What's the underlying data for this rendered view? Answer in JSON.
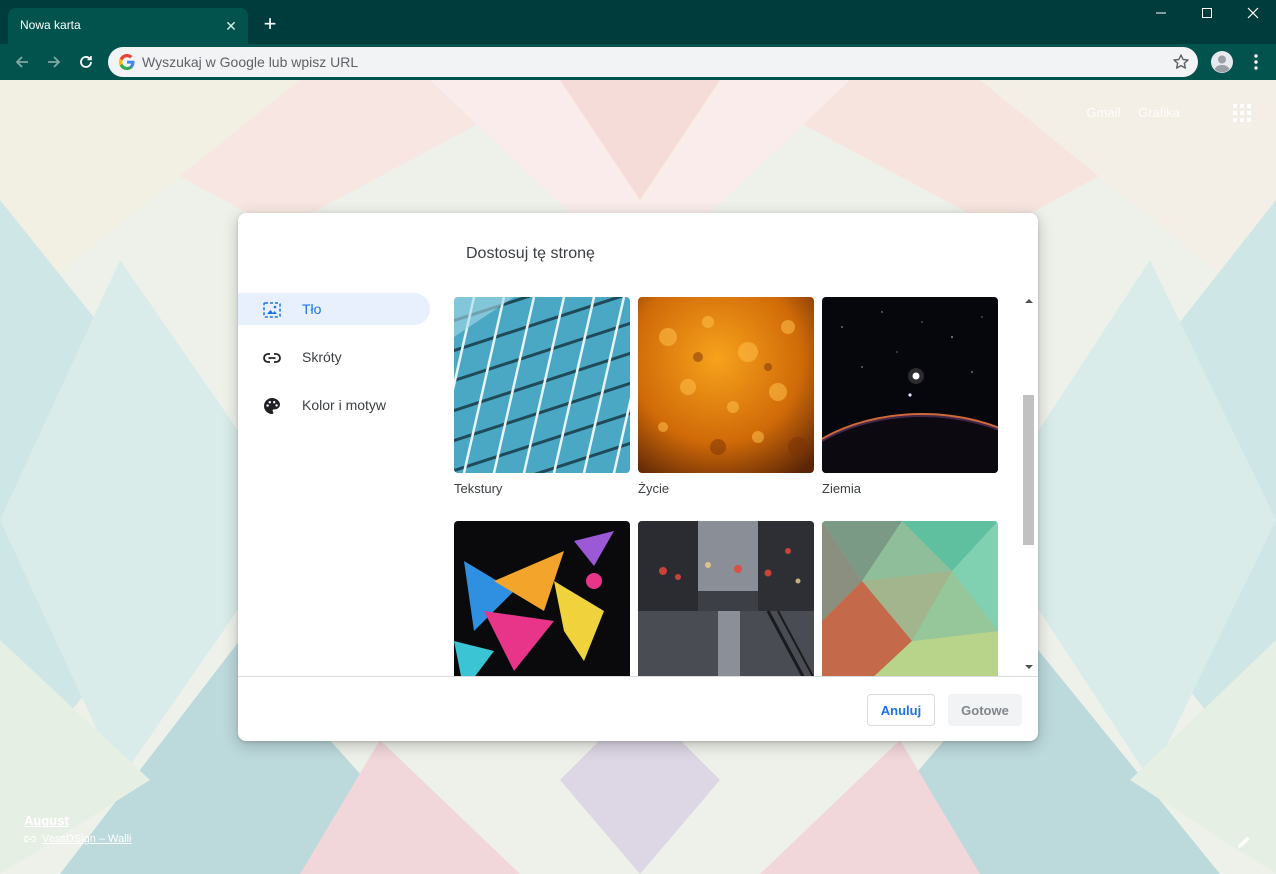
{
  "browser": {
    "tab_title": "Nowa karta",
    "omnibox_placeholder": "Wyszukaj w Google lub wpisz URL",
    "theme_color": "#02524d"
  },
  "ntp": {
    "top_links": [
      "Gmail",
      "Grafika"
    ],
    "attribution_title": "August",
    "attribution_link": "VessDSign – Walli"
  },
  "dialog": {
    "title": "Dostosuj tę stronę",
    "sidebar": [
      {
        "label": "Tło",
        "icon": "background-image-icon",
        "active": true
      },
      {
        "label": "Skróty",
        "icon": "link-icon",
        "active": false
      },
      {
        "label": "Kolor i motyw",
        "icon": "palette-icon",
        "active": false
      }
    ],
    "collections": [
      {
        "label": "Tekstury"
      },
      {
        "label": "Życie"
      },
      {
        "label": "Ziemia"
      },
      {
        "label": ""
      },
      {
        "label": ""
      },
      {
        "label": ""
      }
    ],
    "cancel_label": "Anuluj",
    "done_label": "Gotowe",
    "accent_color": "#1a73e8"
  }
}
